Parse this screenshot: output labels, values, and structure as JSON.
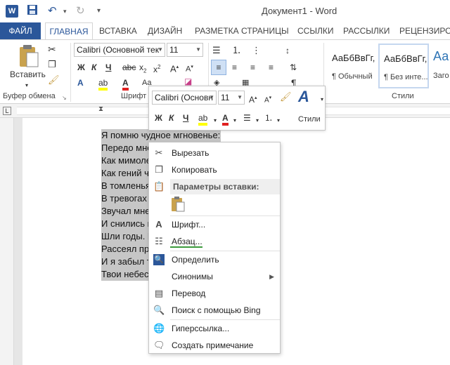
{
  "window": {
    "title": "Документ1 - Word",
    "app_icon": "W"
  },
  "quick_access": [
    {
      "name": "save-icon",
      "glyph": "💾"
    },
    {
      "name": "undo-icon",
      "glyph": "↶"
    },
    {
      "name": "redo-icon",
      "glyph": "↻"
    },
    {
      "name": "customize-icon",
      "glyph": "▾"
    }
  ],
  "tabs": [
    "ФАЙЛ",
    "ГЛАВНАЯ",
    "ВСТАВКА",
    "ДИЗАЙН",
    "РАЗМЕТКА СТРАНИЦЫ",
    "ССЫЛКИ",
    "РАССЫЛКИ",
    "РЕЦЕНЗИРО"
  ],
  "ribbon": {
    "clipboard": {
      "paste_label": "Вставить",
      "group_label": "Буфер обмена"
    },
    "font": {
      "family": "Calibri (Основной тек",
      "size": "11",
      "group_label": "Шрифт"
    },
    "styles": {
      "group_label": "Стили",
      "items": [
        {
          "sample": "АаБбВвГг,",
          "name": "¶ Обычный"
        },
        {
          "sample": "АаБбВвГг,",
          "name": "¶ Без инте..."
        },
        {
          "sample": "Аа",
          "name": "Заго"
        }
      ]
    }
  },
  "mini_toolbar": {
    "font_family": "Calibri (Основн",
    "font_size": "11",
    "styles_label": "Стили",
    "bold": "Ж",
    "italic": "К",
    "underline": "Ч"
  },
  "document": {
    "lines": [
      "Я помню чудное мгновенье:",
      "Передо мной явилась ты,",
      "Как мимолетное виденье,",
      "Как гений чистой красоты.",
      "В томленьях грусти безнадежной,",
      "В тревогах шумной суеты,",
      "Звучал мне долго голос нежный",
      "И снились милые черты.",
      "Шли годы. Бурь порыв мятежный",
      "Рассеял прежние мечты,",
      "И я забыл твой голос нежный,",
      "Твои небесные черты."
    ]
  },
  "context_menu": {
    "cut": "Вырезать",
    "copy": "Копировать",
    "paste_options": "Параметры вставки:",
    "font": "Шрифт...",
    "paragraph": "Абзац...",
    "define": "Определить",
    "synonyms": "Синонимы",
    "translate": "Перевод",
    "search_bing": "Поиск с помощью Bing",
    "hyperlink": "Гиперссылка...",
    "add_comment": "Создать примечание"
  },
  "colors": {
    "brand": "#2b579a",
    "highlight": "#c6c6c6",
    "accent_green": "#3c9a3c"
  }
}
